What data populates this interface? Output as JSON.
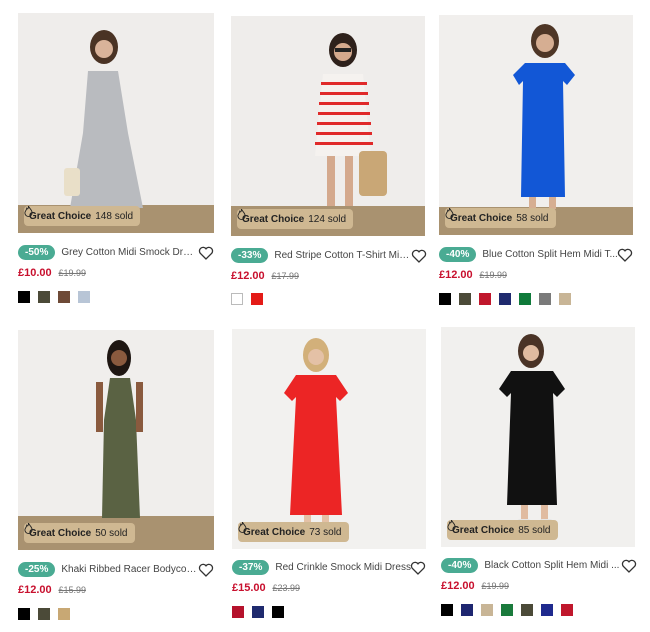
{
  "products": [
    {
      "badge_label": "Great Choice",
      "sold": "148 sold",
      "discount": "-50%",
      "title": "Grey Cotton Midi Smock Dress",
      "price": "£10.00",
      "was_price": "£19.99",
      "swatches": [
        "#000000",
        "#4b4a38",
        "#6e4a37",
        "#b8c5d6"
      ]
    },
    {
      "badge_label": "Great Choice",
      "sold": "124 sold",
      "discount": "-33%",
      "title": "Red Stripe Cotton T-Shirt Mini...",
      "price": "£12.00",
      "was_price": "£17.99",
      "swatches": [
        "#ffffff",
        "#e41b17"
      ]
    },
    {
      "badge_label": "Great Choice",
      "sold": "58 sold",
      "discount": "-40%",
      "title": "Blue Cotton Split Hem Midi T...",
      "price": "£12.00",
      "was_price": "£19.99",
      "swatches": [
        "#000000",
        "#4b4a38",
        "#c0172c",
        "#1f2a6e",
        "#0f7a3a",
        "#7a7a7a",
        "#c8b596"
      ]
    },
    {
      "badge_label": "Great Choice",
      "sold": "50 sold",
      "discount": "-25%",
      "title": "Khaki Ribbed Racer Bodycon ...",
      "price": "£12.00",
      "was_price": "£15.99",
      "swatches": [
        "#000000",
        "#4b4a38",
        "#c8a874"
      ]
    },
    {
      "badge_label": "Great Choice",
      "sold": "73 sold",
      "discount": "-37%",
      "title": "Red Crinkle Smock Midi Dress",
      "price": "£15.00",
      "was_price": "£23.99",
      "swatches": [
        "#b5122c",
        "#1f2a6e",
        "#000000"
      ]
    },
    {
      "badge_label": "Great Choice",
      "sold": "85 sold",
      "discount": "-40%",
      "title": "Black Cotton Split Hem Midi ...",
      "price": "£12.00",
      "was_price": "£19.99",
      "swatches": [
        "#000000",
        "#1e2670",
        "#c8b596",
        "#1a7a3c",
        "#4b4a38",
        "#1f2a8e",
        "#c0172c"
      ]
    }
  ],
  "colors": {
    "accent_discount": "#4aab93",
    "price_red": "#c8102e",
    "badge_bg": "#cfb892"
  },
  "icons": {
    "badge": "fire-icon",
    "favourite": "heart-icon"
  }
}
